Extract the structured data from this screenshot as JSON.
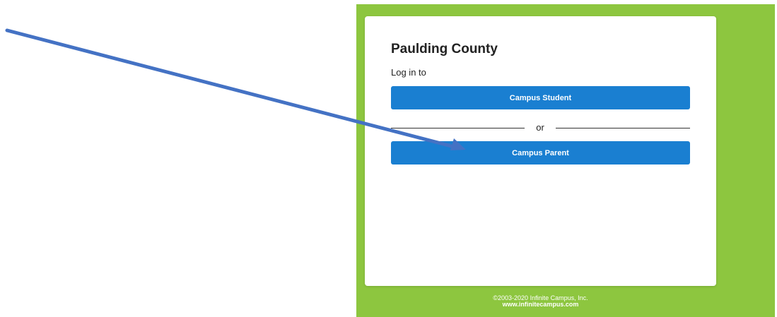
{
  "login": {
    "district_name": "Paulding County",
    "prompt": "Log in to",
    "student_button_label": "Campus Student",
    "divider_text": "or",
    "parent_button_label": "Campus Parent"
  },
  "footer": {
    "copyright": "©2003-2020 Infinite Campus, Inc.",
    "website": "www.infinitecampus.com"
  },
  "colors": {
    "background_panel": "#8dc63f",
    "button": "#1a7fd1",
    "annotation_arrow": "#4472c4"
  }
}
